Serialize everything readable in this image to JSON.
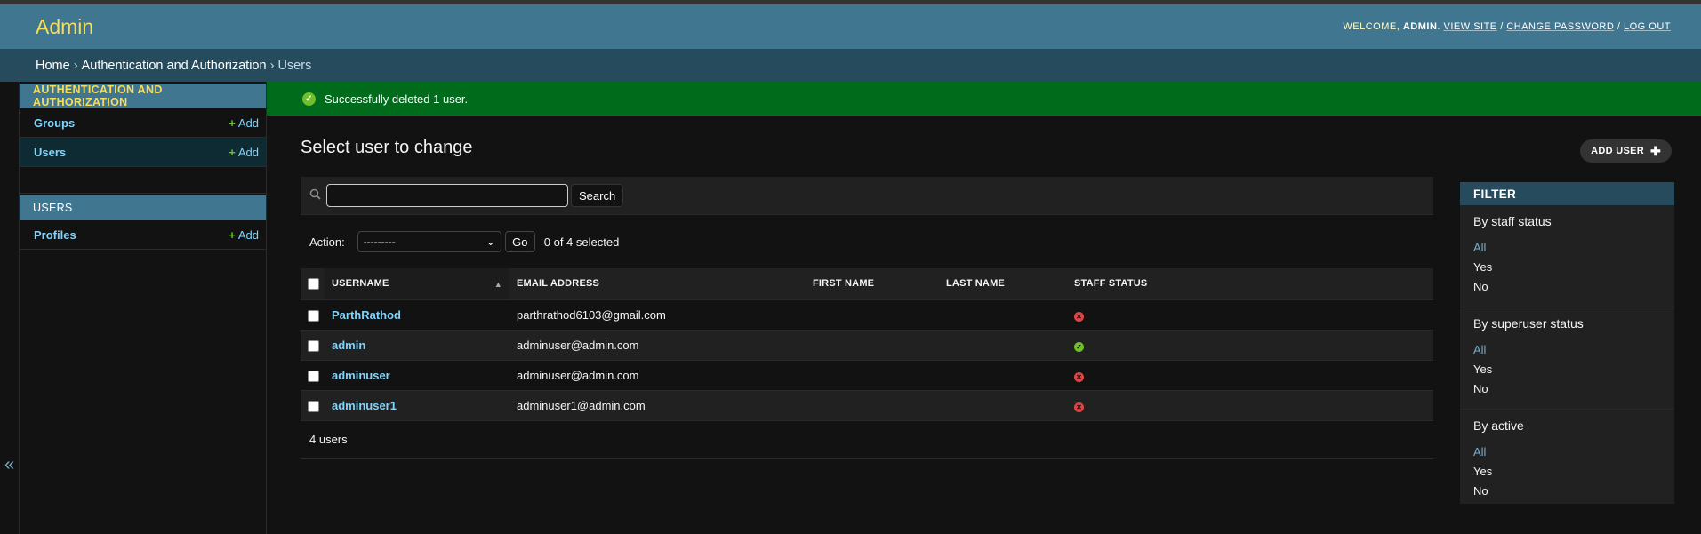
{
  "header": {
    "brand": "Admin",
    "welcome": "Welcome,",
    "username": "admin",
    "view_site": "View site",
    "change_password": "Change password",
    "log_out": "Log out"
  },
  "breadcrumbs": {
    "home": "Home",
    "section": "Authentication and Authorization",
    "current": "Users"
  },
  "sidebar": {
    "collapse_label": "«",
    "modules": [
      {
        "caption": "Authentication and Authorization",
        "items": [
          {
            "label": "Groups",
            "add": "Add"
          },
          {
            "label": "Users",
            "add": "Add"
          }
        ]
      },
      {
        "caption": "Users",
        "items": [
          {
            "label": "Profiles",
            "add": "Add"
          }
        ]
      }
    ]
  },
  "message": "Successfully deleted 1 user.",
  "page_title": "Select user to change",
  "add_button": "Add user",
  "search": {
    "value": "",
    "button": "Search"
  },
  "actions": {
    "label": "Action:",
    "selected_option": "---------",
    "go": "Go",
    "selection": "0 of 4 selected"
  },
  "table": {
    "columns": [
      "Username",
      "Email address",
      "First name",
      "Last name",
      "Staff status"
    ],
    "rows": [
      {
        "username": "ParthRathod",
        "email": "parthrathod6103@gmail.com",
        "first_name": "",
        "last_name": "",
        "staff": false
      },
      {
        "username": "admin",
        "email": "adminuser@admin.com",
        "first_name": "",
        "last_name": "",
        "staff": true
      },
      {
        "username": "adminuser",
        "email": "adminuser@admin.com",
        "first_name": "",
        "last_name": "",
        "staff": false
      },
      {
        "username": "adminuser1",
        "email": "adminuser1@admin.com",
        "first_name": "",
        "last_name": "",
        "staff": false
      }
    ]
  },
  "paginator": "4 users",
  "filter": {
    "caption": "Filter",
    "groups": [
      {
        "title": "By staff status",
        "options": [
          "All",
          "Yes",
          "No"
        ]
      },
      {
        "title": "By superuser status",
        "options": [
          "All",
          "Yes",
          "No"
        ]
      },
      {
        "title": "By active",
        "options": [
          "All",
          "Yes",
          "No"
        ]
      }
    ]
  },
  "colors": {
    "header": "#417690",
    "breadcrumbs": "#264b5d",
    "success": "#006b1b",
    "link": "#81d4fa",
    "brand": "#f5dd5d"
  }
}
